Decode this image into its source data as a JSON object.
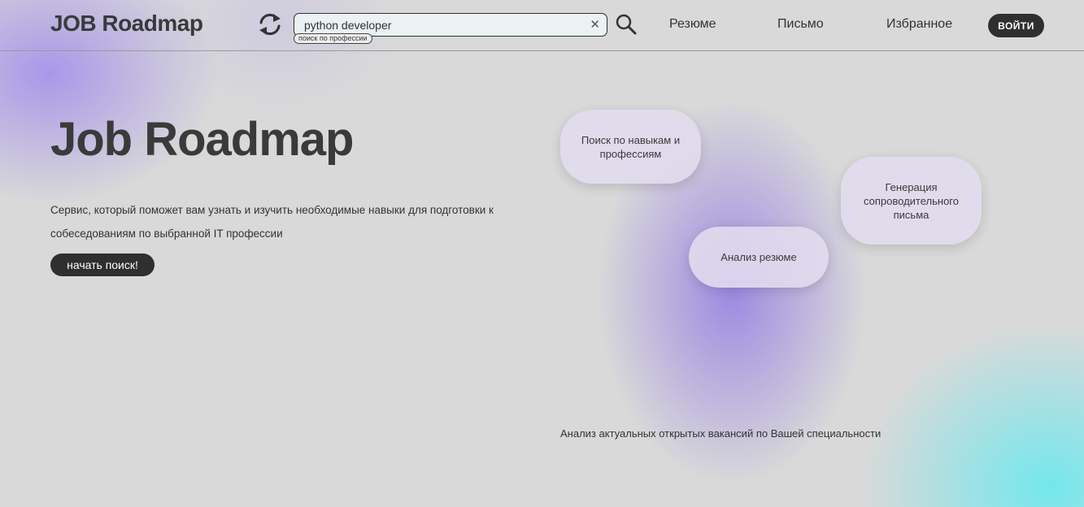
{
  "header": {
    "logo": "JOB Roadmap",
    "search": {
      "value": "python developer",
      "placeholder": "python developer",
      "hint": "поиск по профессии"
    },
    "nav": {
      "resume": "Резюме",
      "letter": "Письмо",
      "favorites": "Избранное"
    },
    "login_label": "ВОЙТИ"
  },
  "hero": {
    "title": "Job Roadmap",
    "description": "Сервис, который поможет вам узнать и изучить необходимые навыки для подготовки к собеседованиям по выбранной IT профессии",
    "start_label": "начать поиск!"
  },
  "features": {
    "search": "Поиск по навыкам и профессиям",
    "cover_letter": "Генерация сопроводительного письма",
    "resume": "Анализ резюме",
    "vacancies": "Анализ актуальных открытых вакансий по Вашей специальности"
  },
  "icons": {
    "refresh": "refresh-icon",
    "search": "search-icon",
    "clear": "close-icon"
  },
  "colors": {
    "dark": "#2f2f2f",
    "background": "#d9d9d9",
    "purple": "#8e76e4",
    "cyan": "#6ee8ee"
  }
}
